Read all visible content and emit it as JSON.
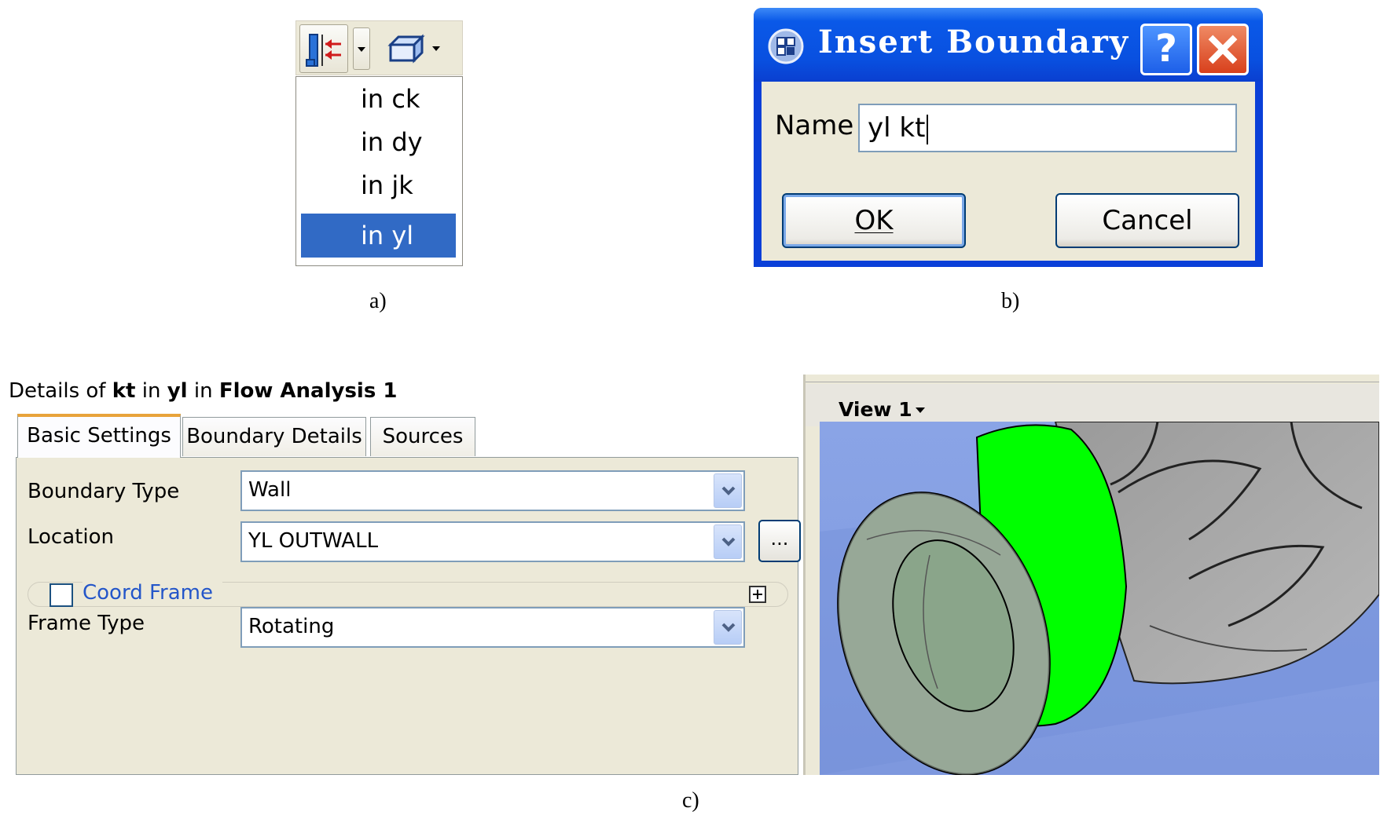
{
  "panel_a": {
    "caption": "a)",
    "toolbar": {
      "boundary_icon": "boundary-in-out-icon",
      "domain_icon": "domain-box-icon"
    },
    "menu_items": [
      "in ck",
      "in dy",
      "in jk",
      "in yl"
    ],
    "selected_index": 3
  },
  "panel_b": {
    "caption": "b)",
    "dialog": {
      "title": "Insert Boundary",
      "help_label": "?",
      "name_label": "Name",
      "name_value": "yl kt",
      "ok_label": "OK",
      "cancel_label": "Cancel"
    },
    "colors": {
      "titlebar": "#0a59e8",
      "close": "#d8401c"
    }
  },
  "panel_c": {
    "caption": "c)",
    "details": {
      "title_prefix": "Details of ",
      "boundary": "kt",
      "in_1": " in ",
      "domain": "yl",
      "in_2": " in ",
      "analysis": "Flow Analysis 1",
      "tabs": [
        "Basic Settings",
        "Boundary Details",
        "Sources"
      ],
      "active_tab": 0,
      "fields": {
        "boundary_type_label": "Boundary Type",
        "boundary_type_value": "Wall",
        "location_label": "Location",
        "location_value": "YL OUTWALL",
        "browse_label": "...",
        "coord_frame_label": "Coord Frame",
        "coord_frame_checked": false,
        "frame_type_label": "Frame Type",
        "frame_type_value": "Rotating"
      }
    },
    "viewer": {
      "view_label": "View 1",
      "colors": {
        "background": "#8ea8e6",
        "highlight": "#00ff00",
        "model": "#a9a9a9"
      }
    }
  }
}
